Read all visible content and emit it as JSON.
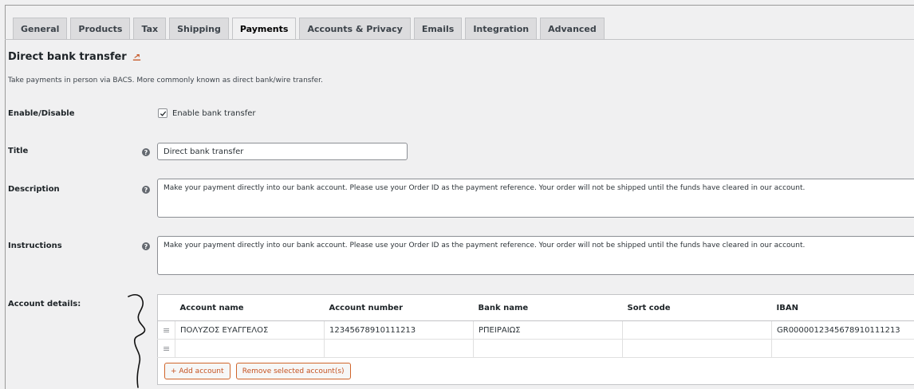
{
  "tabs": [
    {
      "label": "General"
    },
    {
      "label": "Products"
    },
    {
      "label": "Tax"
    },
    {
      "label": "Shipping"
    },
    {
      "label": "Payments",
      "active": true
    },
    {
      "label": "Accounts & Privacy"
    },
    {
      "label": "Emails"
    },
    {
      "label": "Integration"
    },
    {
      "label": "Advanced"
    }
  ],
  "section": {
    "title": "Direct bank transfer",
    "title_icon": "return-arrow-icon",
    "description": "Take payments in person via BACS. More commonly known as direct bank/wire transfer."
  },
  "fields": {
    "enable": {
      "label": "Enable/Disable",
      "checkbox_label": "Enable bank transfer",
      "checked": true
    },
    "title": {
      "label": "Title",
      "value": "Direct bank transfer"
    },
    "description": {
      "label": "Description",
      "value": "Make your payment directly into our bank account. Please use your Order ID as the payment reference. Your order will not be shipped until the funds have cleared in our account."
    },
    "instructions": {
      "label": "Instructions",
      "value": "Make your payment directly into our bank account. Please use your Order ID as the payment reference. Your order will not be shipped until the funds have cleared in our account."
    },
    "account_details": {
      "label": "Account details:"
    }
  },
  "accounts": {
    "columns": [
      "Account name",
      "Account number",
      "Bank name",
      "Sort code",
      "IBAN"
    ],
    "rows": [
      [
        "ΠΟΛΥΖΟΣ ΕΥΑΓΓΕΛΟΣ",
        "12345678910111213",
        "ΡΠΕΙΡΑΙΩΣ",
        "",
        "GR0000012345678910111213"
      ],
      [
        "",
        "",
        "",
        "",
        ""
      ]
    ],
    "add_label": "+ Add account",
    "remove_label": "Remove selected account(s)"
  },
  "colors": {
    "accent": "#c55220",
    "active_tab": "#f0f0f1",
    "tab": "#dcdcde"
  }
}
